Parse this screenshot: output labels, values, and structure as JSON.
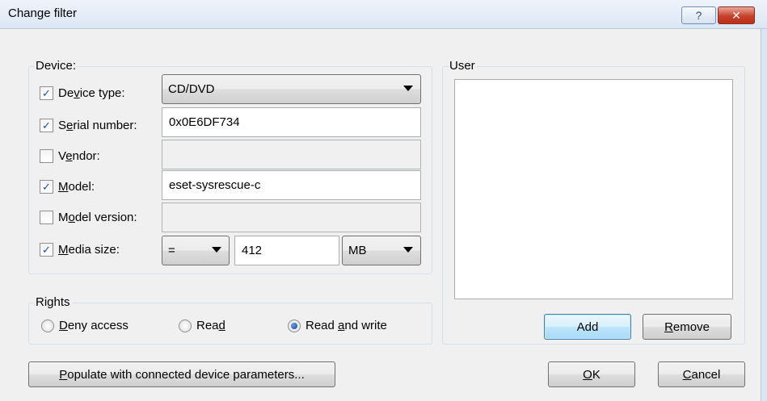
{
  "window": {
    "title": "Change filter",
    "help_label": "?",
    "close_label": "✕"
  },
  "device": {
    "group_label": "Device:",
    "device_type": {
      "label_before": "De",
      "label_u": "v",
      "label_after": "ice type:",
      "checked": true,
      "value": "CD/DVD"
    },
    "serial_number": {
      "label_before": "S",
      "label_u": "e",
      "label_after": "rial number:",
      "checked": true,
      "value": "0x0E6DF734"
    },
    "vendor": {
      "label_before": "V",
      "label_u": "e",
      "label_after": "ndor:",
      "checked": false,
      "value": ""
    },
    "model": {
      "label_before": "",
      "label_u": "M",
      "label_after": "odel:",
      "checked": true,
      "value": "eset-sysrescue-c"
    },
    "model_version": {
      "label_before": "M",
      "label_u": "o",
      "label_after": "del version:",
      "checked": false,
      "value": ""
    },
    "media_size": {
      "label_before": "",
      "label_u": "M",
      "label_after": "edia size:",
      "checked": true,
      "operator": "=",
      "value": "412",
      "unit": "MB"
    }
  },
  "rights": {
    "group_label": "Rights",
    "deny": {
      "label_u": "D",
      "label_after": "eny access",
      "selected": false
    },
    "read": {
      "label_before": "Rea",
      "label_u": "d",
      "label_after": "",
      "selected": false
    },
    "read_write": {
      "label_before": "Read ",
      "label_u": "a",
      "label_after": "nd write",
      "selected": true
    }
  },
  "user": {
    "group_label": "User",
    "add_label": "Add",
    "remove_u": "R",
    "remove_after": "emove"
  },
  "footer": {
    "populate_u": "P",
    "populate_after": "opulate with connected device parameters...",
    "ok_u": "O",
    "ok_after": "K",
    "cancel_u": "C",
    "cancel_after": "ancel"
  },
  "icons": {
    "check": "checkmark-icon",
    "dropdown": "chevron-down-icon"
  }
}
